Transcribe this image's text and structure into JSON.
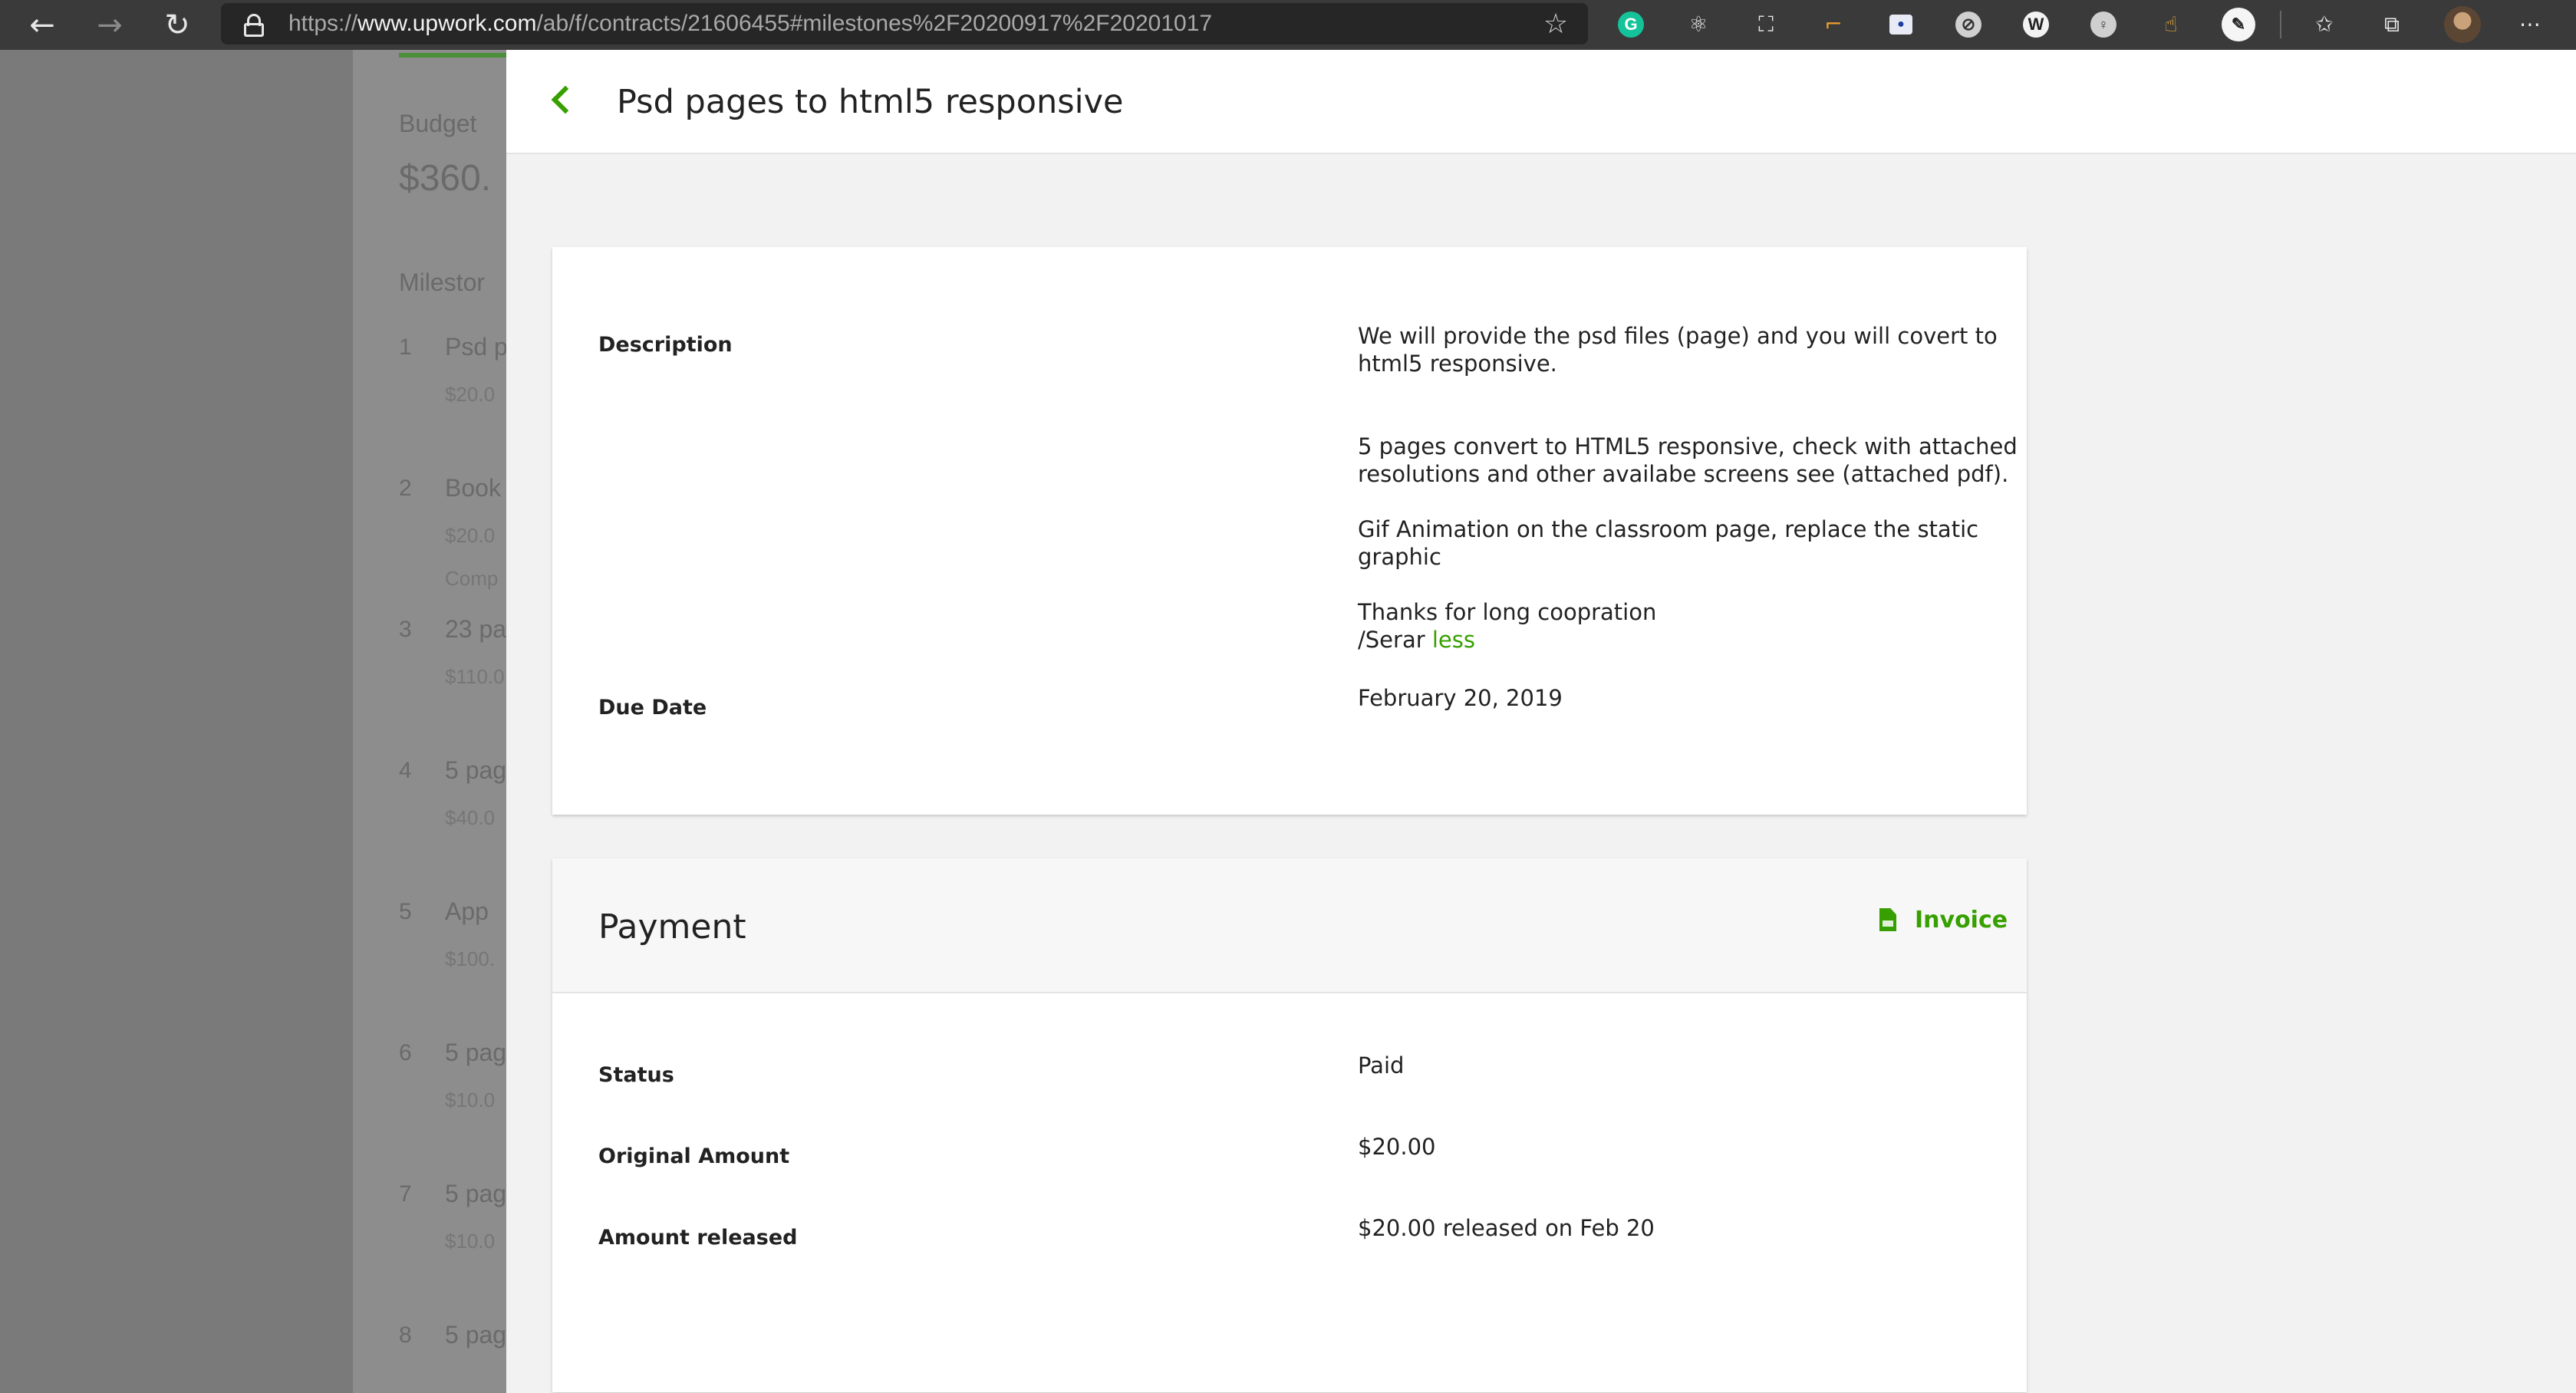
{
  "browser": {
    "url_scheme": "https://",
    "url_host": "www.upwork.com",
    "url_path": "/ab/f/contracts/21606455#milestones%2F20200917%2F20201017"
  },
  "background_page": {
    "budget_label": "Budget",
    "budget_value": "$360.",
    "milestones_label": "Milestor",
    "milestones": [
      {
        "num": "1",
        "title": "Psd p",
        "amount": "$20.0",
        "extra": ""
      },
      {
        "num": "2",
        "title": "Book",
        "amount": "$20.0",
        "extra": "Comp"
      },
      {
        "num": "3",
        "title": "23 pa",
        "amount": "$110.0",
        "extra": ""
      },
      {
        "num": "4",
        "title": "5 pag",
        "amount": "$40.0",
        "extra": ""
      },
      {
        "num": "5",
        "title": "App",
        "amount": "$100.",
        "extra": ""
      },
      {
        "num": "6",
        "title": "5 pag",
        "amount": "$10.0",
        "extra": ""
      },
      {
        "num": "7",
        "title": "5 pag",
        "amount": "$10.0",
        "extra": ""
      },
      {
        "num": "8",
        "title": "5 pag",
        "amount": "",
        "extra": ""
      }
    ]
  },
  "drawer": {
    "title": "Psd pages to html5 responsive",
    "details": {
      "description_label": "Description",
      "description_lines": [
        "We will provide the psd files (page) and you will covert to",
        "html5 responsive.",
        "5 pages convert to HTML5 responsive, check with attached",
        "resolutions and other availabe screens see (attached pdf).",
        "Gif Animation on the classroom page, replace the static",
        "graphic",
        "Thanks for long coopration",
        "/Serar"
      ],
      "less_link": "less",
      "due_date_label": "Due Date",
      "due_date_value": "February 20, 2019"
    },
    "payment": {
      "title": "Payment",
      "invoice_label": "Invoice",
      "status_label": "Status",
      "status_value": "Paid",
      "original_amount_label": "Original Amount",
      "original_amount_value": "$20.00",
      "amount_released_label": "Amount released",
      "amount_released_value": "$20.00 released on Feb 20"
    }
  },
  "colors": {
    "accent": "#37a000",
    "overlay": "#7a7a7a"
  }
}
